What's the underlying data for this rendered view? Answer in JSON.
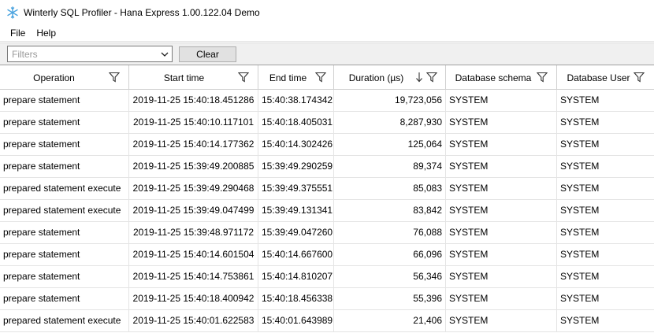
{
  "window": {
    "title": "Winterly SQL Profiler - Hana Express 1.00.122.04 Demo"
  },
  "menu": {
    "items": [
      {
        "label": "File"
      },
      {
        "label": "Help"
      }
    ]
  },
  "toolbar": {
    "filter_placeholder": "Filters",
    "clear_label": "Clear"
  },
  "table": {
    "sort_column": "Duration (µs)",
    "sort_direction": "descending",
    "headers": [
      {
        "label": "Operation"
      },
      {
        "label": "Start time"
      },
      {
        "label": "End time"
      },
      {
        "label": "Duration (µs)"
      },
      {
        "label": "Database schema"
      },
      {
        "label": "Database User"
      }
    ],
    "rows": [
      {
        "op": "prepare statement",
        "start": "2019-11-25 15:40:18.451286",
        "end": "15:40:38.174342",
        "dur": "19,723,056",
        "schema": "SYSTEM",
        "user": "SYSTEM"
      },
      {
        "op": "prepare statement",
        "start": "2019-11-25 15:40:10.117101",
        "end": "15:40:18.405031",
        "dur": "8,287,930",
        "schema": "SYSTEM",
        "user": "SYSTEM"
      },
      {
        "op": "prepare statement",
        "start": "2019-11-25 15:40:14.177362",
        "end": "15:40:14.302426",
        "dur": "125,064",
        "schema": "SYSTEM",
        "user": "SYSTEM"
      },
      {
        "op": "prepare statement",
        "start": "2019-11-25 15:39:49.200885",
        "end": "15:39:49.290259",
        "dur": "89,374",
        "schema": "SYSTEM",
        "user": "SYSTEM"
      },
      {
        "op": "prepared statement execute",
        "start": "2019-11-25 15:39:49.290468",
        "end": "15:39:49.375551",
        "dur": "85,083",
        "schema": "SYSTEM",
        "user": "SYSTEM"
      },
      {
        "op": "prepared statement execute",
        "start": "2019-11-25 15:39:49.047499",
        "end": "15:39:49.131341",
        "dur": "83,842",
        "schema": "SYSTEM",
        "user": "SYSTEM"
      },
      {
        "op": "prepare statement",
        "start": "2019-11-25 15:39:48.971172",
        "end": "15:39:49.047260",
        "dur": "76,088",
        "schema": "SYSTEM",
        "user": "SYSTEM"
      },
      {
        "op": "prepare statement",
        "start": "2019-11-25 15:40:14.601504",
        "end": "15:40:14.667600",
        "dur": "66,096",
        "schema": "SYSTEM",
        "user": "SYSTEM"
      },
      {
        "op": "prepare statement",
        "start": "2019-11-25 15:40:14.753861",
        "end": "15:40:14.810207",
        "dur": "56,346",
        "schema": "SYSTEM",
        "user": "SYSTEM"
      },
      {
        "op": "prepare statement",
        "start": "2019-11-25 15:40:18.400942",
        "end": "15:40:18.456338",
        "dur": "55,396",
        "schema": "SYSTEM",
        "user": "SYSTEM"
      },
      {
        "op": "prepared statement execute",
        "start": "2019-11-25 15:40:01.622583",
        "end": "15:40:01.643989",
        "dur": "21,406",
        "schema": "SYSTEM",
        "user": "SYSTEM"
      }
    ]
  },
  "colors": {
    "app_icon": "#4aa3df",
    "grid_line": "#e4e4e4",
    "header_line": "#d0d0d0"
  },
  "icons": {
    "app": "snowflake-icon",
    "filter": "funnel-icon",
    "sort": "sort-down-arrow-icon",
    "dropdown": "chevron-down-icon"
  }
}
